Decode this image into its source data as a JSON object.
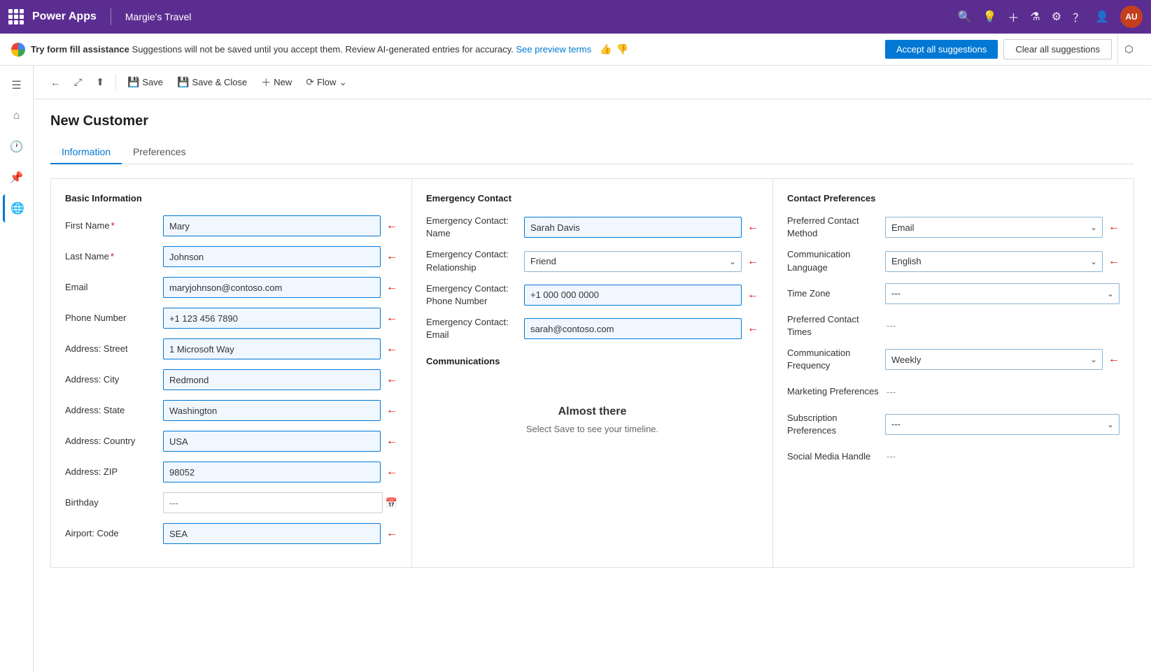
{
  "topBar": {
    "appName": "Power Apps",
    "recordName": "Margie's Travel",
    "avatarInitials": "AU"
  },
  "suggestionBar": {
    "boldText": "Try form fill assistance",
    "mainText": " Suggestions will not be saved until you accept them. Review AI-generated entries for accuracy. ",
    "linkText": "See preview terms",
    "acceptLabel": "Accept all suggestions",
    "clearLabel": "Clear all suggestions"
  },
  "toolbar": {
    "backLabel": "←",
    "saveLabel": "Save",
    "saveCloseLabel": "Save & Close",
    "newLabel": "New",
    "flowLabel": "Flow"
  },
  "formTitle": "New Customer",
  "tabs": [
    {
      "label": "Information",
      "active": true
    },
    {
      "label": "Preferences",
      "active": false
    }
  ],
  "basicInfo": {
    "title": "Basic Information",
    "fields": [
      {
        "label": "First Name",
        "required": true,
        "value": "Mary",
        "type": "input",
        "highlighted": true,
        "arrow": true
      },
      {
        "label": "Last Name",
        "required": true,
        "value": "Johnson",
        "type": "input",
        "highlighted": true,
        "arrow": true
      },
      {
        "label": "Email",
        "required": false,
        "value": "maryjohnson@contoso.com",
        "type": "input",
        "highlighted": true,
        "arrow": true
      },
      {
        "label": "Phone Number",
        "required": false,
        "value": "+1 123 456 7890",
        "type": "input",
        "highlighted": true,
        "arrow": true
      },
      {
        "label": "Address: Street",
        "required": false,
        "value": "1 Microsoft Way",
        "type": "input",
        "highlighted": true,
        "arrow": true
      },
      {
        "label": "Address: City",
        "required": false,
        "value": "Redmond",
        "type": "input",
        "highlighted": true,
        "arrow": true
      },
      {
        "label": "Address: State",
        "required": false,
        "value": "Washington",
        "type": "input",
        "highlighted": true,
        "arrow": true
      },
      {
        "label": "Address: Country",
        "required": false,
        "value": "USA",
        "type": "input",
        "highlighted": true,
        "arrow": true
      },
      {
        "label": "Address: ZIP",
        "required": false,
        "value": "98052",
        "type": "input",
        "highlighted": true,
        "arrow": true
      },
      {
        "label": "Birthday",
        "required": false,
        "value": "---",
        "type": "date",
        "highlighted": false,
        "arrow": false
      },
      {
        "label": "Airport: Code",
        "required": false,
        "value": "SEA",
        "type": "input",
        "highlighted": true,
        "arrow": true
      }
    ]
  },
  "emergencyContact": {
    "title": "Emergency Contact",
    "fields": [
      {
        "label": "Emergency Contact: Name",
        "value": "Sarah Davis",
        "type": "input",
        "highlighted": true,
        "arrow": true
      },
      {
        "label": "Emergency Contact: Relationship",
        "value": "Friend",
        "type": "select",
        "highlighted": true,
        "arrow": true
      },
      {
        "label": "Emergency Contact: Phone Number",
        "value": "+1 000 000 0000",
        "type": "input",
        "highlighted": true,
        "arrow": true
      },
      {
        "label": "Emergency Contact: Email",
        "value": "sarah@contoso.com",
        "type": "input",
        "highlighted": true,
        "arrow": true
      }
    ],
    "commsTitle": "Communications",
    "almostThereTitle": "Almost there",
    "almostThereText": "Select Save to see your timeline."
  },
  "contactPrefs": {
    "title": "Contact Preferences",
    "fields": [
      {
        "label": "Preferred Contact Method",
        "value": "Email",
        "type": "select",
        "highlighted": true,
        "arrow": true
      },
      {
        "label": "Communication Language",
        "value": "English",
        "type": "select",
        "highlighted": true,
        "arrow": true
      },
      {
        "label": "Time Zone",
        "value": "---",
        "type": "select",
        "highlighted": false,
        "arrow": false
      },
      {
        "label": "Preferred Contact Times",
        "value": "---",
        "type": "text",
        "highlighted": false,
        "arrow": false
      },
      {
        "label": "Communication Frequency",
        "value": "Weekly",
        "type": "select",
        "highlighted": true,
        "arrow": true
      },
      {
        "label": "Marketing Preferences",
        "value": "---",
        "type": "text",
        "highlighted": false,
        "arrow": false
      },
      {
        "label": "Subscription Preferences",
        "value": "---",
        "type": "select",
        "highlighted": false,
        "arrow": false
      },
      {
        "label": "Social Media Handle",
        "value": "---",
        "type": "text",
        "highlighted": false,
        "arrow": false
      }
    ]
  },
  "sidebar": {
    "icons": [
      {
        "name": "menu-icon",
        "symbol": "☰"
      },
      {
        "name": "home-icon",
        "symbol": "⌂"
      },
      {
        "name": "recent-icon",
        "symbol": "🕐"
      },
      {
        "name": "pin-icon",
        "symbol": "📌"
      },
      {
        "name": "globe-icon",
        "symbol": "🌐"
      }
    ]
  }
}
